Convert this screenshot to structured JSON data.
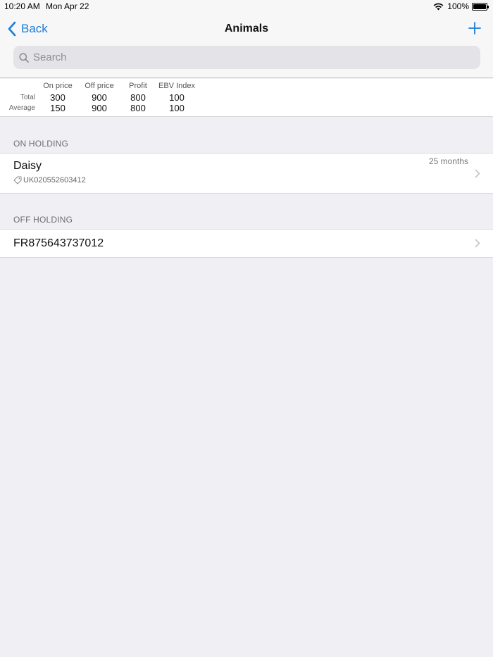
{
  "status": {
    "time": "10:20 AM",
    "date": "Mon Apr 22",
    "battery": "100%"
  },
  "nav": {
    "back_label": "Back",
    "title": "Animals",
    "accent": "#1a7bd9"
  },
  "search": {
    "placeholder": "Search",
    "value": ""
  },
  "summary": {
    "columns": [
      "On price",
      "Off price",
      "Profit",
      "EBV Index"
    ],
    "rows": [
      {
        "label": "Total",
        "values": [
          "300",
          "900",
          "800",
          "100"
        ]
      },
      {
        "label": "Average",
        "values": [
          "150",
          "900",
          "800",
          "100"
        ]
      }
    ]
  },
  "sections": [
    {
      "header": "ON HOLDING",
      "items": [
        {
          "title": "Daisy",
          "tag": "UK020552603412",
          "right": "25 months"
        }
      ]
    },
    {
      "header": "OFF HOLDING",
      "items": [
        {
          "title": "FR875643737012"
        }
      ]
    }
  ],
  "icons": {
    "back": "chevron-left-icon",
    "add": "plus-icon",
    "search": "search-icon",
    "tag": "tag-icon",
    "disclosure": "chevron-right-icon"
  }
}
